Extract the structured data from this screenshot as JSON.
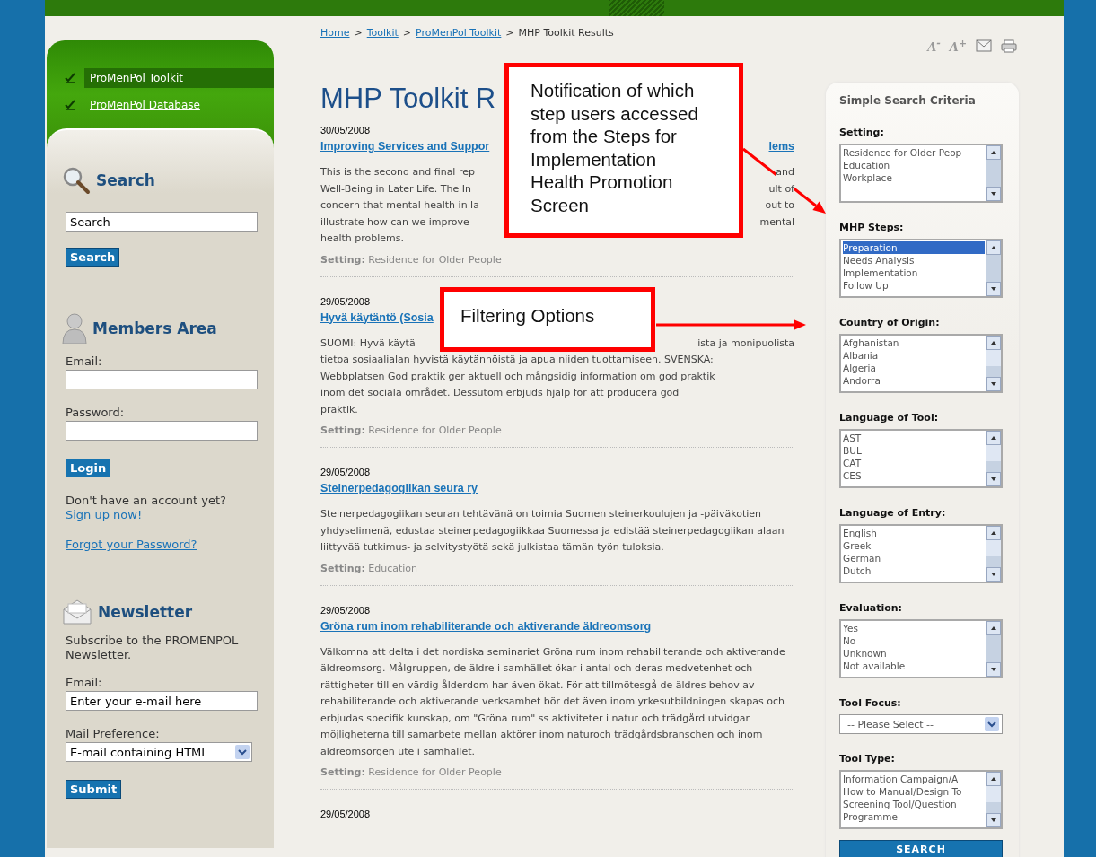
{
  "breadcrumb": [
    {
      "kind": "link",
      "label": "Home"
    },
    {
      "kind": "sep",
      "label": ">"
    },
    {
      "kind": "link",
      "label": "Toolkit"
    },
    {
      "kind": "sep",
      "label": ">"
    },
    {
      "kind": "link",
      "label": "ProMenPol Toolkit"
    },
    {
      "kind": "sep",
      "label": ">"
    },
    {
      "kind": "current",
      "label": "MHP Toolkit Results"
    }
  ],
  "tools": [
    {
      "kind": "text-smaller",
      "label": "A$^{-}$"
    },
    {
      "kind": "text-larger",
      "label": "A$^{+}$"
    },
    {
      "kind": "email"
    },
    {
      "kind": "print"
    }
  ],
  "nav": [
    {
      "label": "ProMenPol Toolkit",
      "selected": true
    },
    {
      "label": "ProMenPol Database",
      "selected": false
    }
  ],
  "search": {
    "title": "Search",
    "value": "Search",
    "button": "Search"
  },
  "members": {
    "title": "Members Area",
    "email_label": "Email:",
    "password_label": "Password:",
    "button": "Login",
    "prompt": "Don't have an account yet?",
    "signup": "Sign up now!",
    "forgot": "Forgot your Password?"
  },
  "newsletter": {
    "title": "Newsletter",
    "text": "Subscribe to the PROMENPOL Newsletter.",
    "email_label": "Email:",
    "email_value": "Enter your e-mail here",
    "pref_label": "Mail Preference:",
    "pref_value": "E-mail containing HTML",
    "button": "Submit"
  },
  "main": {
    "title": "MHP Toolkit R",
    "articles": [
      {
        "kind": "covered",
        "date": "30/05/2008",
        "title": [
          "Improving Services and Suppor",
          "lems"
        ],
        "lines": [
          [
            "This is the second and final rep",
            "and"
          ],
          [
            "Well-Being in Later Life. The In",
            "ult of"
          ],
          [
            "concern that mental health in la",
            "out to"
          ],
          [
            "illustrate how can we improve",
            "mental"
          ],
          [
            "health problems."
          ]
        ],
        "setting": "**Setting:** Residence for Older People"
      },
      {
        "kind": "covered",
        "date": "29/05/2008",
        "title": [
          "Hyvä käytäntö (Sosia"
        ],
        "lines": [
          [
            "SUOMI: Hyvä käytä",
            "ista ja monipuolista"
          ],
          [
            "tietoa sosiaalialan hyvistä käytännöistä ja apua niiden tuottamiseen. SVENSKA:"
          ],
          [
            "Webbplatsen God praktik ger aktuell och mångsidig information om god praktik"
          ],
          [
            "inom det sociala området. Dessutom erbjuds hjälp för att producera god"
          ],
          [
            "praktik."
          ]
        ],
        "setting": "**Setting:** Residence for Older People"
      },
      {
        "kind": "plain",
        "date": "29/05/2008",
        "title": [
          "Steinerpedagogiikan seura ry"
        ],
        "body": "Steinerpedagogiikan seuran tehtävänä on toimia Suomen steinerkoulujen ja -päiväkotien yhdyselimenä, edustaa steinerpedagogiikkaa Suomessa ja edistää steinerpedagogiikan alaan liittyvää tutkimus- ja selvitystyötä sekä julkistaa tämän työn tuloksia.",
        "setting": "**Setting:** Education"
      },
      {
        "kind": "plain",
        "date": "29/05/2008",
        "title": [
          "Gröna rum inom rehabiliterande och aktiverande äldreomsorg"
        ],
        "body": "Välkomna att delta i det nordiska seminariet Gröna rum inom rehabiliterande och aktiverande äldreomsorg. Målgruppen, de äldre i samhället ökar i antal och deras medvetenhet och rättigheter till en värdig ålderdom har även ökat. För att tillmötesgå de äldres behov av rehabiliterande och aktiverande verksamhet bör det även inom yrkesutbildningen skapas och erbjudas specifik kunskap, om \"Gröna rum\" ss aktiviteter i natur och trädgård utvidgar möjligheterna till samarbete mellan aktörer inom naturoch trädgårdsbranschen och inom äldreomsorgen ute i samhället.",
        "setting": "**Setting:** Residence for Older People"
      },
      {
        "kind": "plain",
        "date": "29/05/2008"
      }
    ]
  },
  "callouts": [
    {
      "kind": "notification",
      "text": "Notification of which step users accessed from the Steps for Implementation Health Promotion Screen"
    },
    {
      "kind": "filtering",
      "text": "Filtering Options"
    }
  ],
  "criteria": {
    "title": "Simple Search Criteria",
    "filters": [
      {
        "kind": "listbox",
        "label": "Setting:",
        "options": [
          {
            "label": "Residence for Older Peop",
            "selected": false
          },
          {
            "label": "Education",
            "selected": false
          },
          {
            "label": "Workplace",
            "selected": false
          }
        ]
      },
      {
        "kind": "listbox",
        "label": "MHP Steps:",
        "options": [
          {
            "label": "Preparation",
            "selected": true
          },
          {
            "label": "Needs Analysis",
            "selected": false
          },
          {
            "label": "Implementation",
            "selected": false
          },
          {
            "label": "Follow Up",
            "selected": false
          }
        ]
      },
      {
        "kind": "listbox",
        "label": "Country of Origin:",
        "options": [
          {
            "label": "Afghanistan",
            "selected": false
          },
          {
            "label": "Albania",
            "selected": false
          },
          {
            "label": "Algeria",
            "selected": false
          },
          {
            "label": "Andorra",
            "selected": false
          }
        ]
      },
      {
        "kind": "listbox",
        "label": "Language of Tool:",
        "options": [
          {
            "label": "AST",
            "selected": false
          },
          {
            "label": "BUL",
            "selected": false
          },
          {
            "label": "CAT",
            "selected": false
          },
          {
            "label": "CES",
            "selected": false
          }
        ]
      },
      {
        "kind": "listbox",
        "label": "Language of Entry:",
        "options": [
          {
            "label": "English",
            "selected": false
          },
          {
            "label": "Greek",
            "selected": false
          },
          {
            "label": "German",
            "selected": false
          },
          {
            "label": "Dutch",
            "selected": false
          }
        ]
      },
      {
        "kind": "listbox",
        "label": "Evaluation:",
        "options": [
          {
            "label": "Yes",
            "selected": false
          },
          {
            "label": "No",
            "selected": false
          },
          {
            "label": "Unknown",
            "selected": false
          },
          {
            "label": "Not available",
            "selected": false
          }
        ]
      },
      {
        "kind": "dropdown",
        "label": "Tool Focus:",
        "value": "-- Please Select --"
      },
      {
        "kind": "listbox",
        "label": "Tool Type:",
        "options": [
          {
            "label": "Information Campaign/A",
            "selected": false
          },
          {
            "label": "How to Manual/Design To",
            "selected": false
          },
          {
            "label": "Screening Tool/Question",
            "selected": false
          },
          {
            "label": "Programme",
            "selected": false
          }
        ]
      }
    ],
    "button": "SEARCH"
  }
}
